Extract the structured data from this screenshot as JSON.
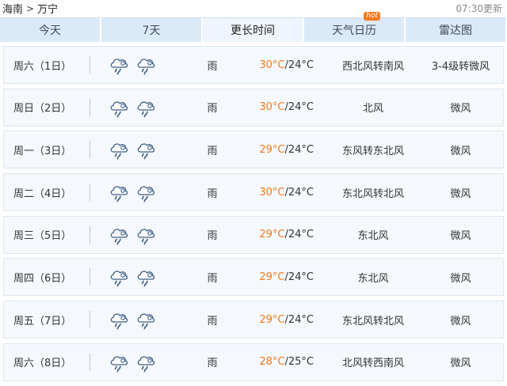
{
  "header": {
    "breadcrumb": {
      "province": "海南",
      "separator": ">",
      "city": "万宁"
    },
    "updated": "07:30更新"
  },
  "tabs": [
    {
      "label": "今天"
    },
    {
      "label": "7天"
    },
    {
      "label": "更长时间",
      "active": true
    },
    {
      "label": "天气日历",
      "badge": "hot"
    },
    {
      "label": "雷达图"
    }
  ],
  "forecast": [
    {
      "day": "周六（1日）",
      "icons": [
        "rain-cloud-icon",
        "rain-cloud-icon"
      ],
      "condition": "雨",
      "high": "30°C",
      "low": "/24°C",
      "wind": "西北风转南风",
      "level": "3-4级转微风"
    },
    {
      "day": "周日（2日）",
      "icons": [
        "rain-cloud-icon",
        "rain-cloud-icon"
      ],
      "condition": "雨",
      "high": "30°C",
      "low": "/24°C",
      "wind": "北风",
      "level": "微风"
    },
    {
      "day": "周一（3日）",
      "icons": [
        "rain-cloud-icon",
        "rain-cloud-icon"
      ],
      "condition": "雨",
      "high": "29°C",
      "low": "/24°C",
      "wind": "东风转东北风",
      "level": "微风"
    },
    {
      "day": "周二（4日）",
      "icons": [
        "rain-cloud-icon",
        "rain-cloud-icon"
      ],
      "condition": "雨",
      "high": "30°C",
      "low": "/24°C",
      "wind": "东北风转北风",
      "level": "微风"
    },
    {
      "day": "周三（5日）",
      "icons": [
        "rain-cloud-icon",
        "rain-cloud-icon"
      ],
      "condition": "雨",
      "high": "29°C",
      "low": "/24°C",
      "wind": "东北风",
      "level": "微风"
    },
    {
      "day": "周四（6日）",
      "icons": [
        "rain-cloud-icon",
        "rain-cloud-icon"
      ],
      "condition": "雨",
      "high": "29°C",
      "low": "/24°C",
      "wind": "东北风",
      "level": "微风"
    },
    {
      "day": "周五（7日）",
      "icons": [
        "rain-cloud-icon",
        "rain-cloud-icon"
      ],
      "condition": "雨",
      "high": "29°C",
      "low": "/24°C",
      "wind": "东北风转北风",
      "level": "微风"
    },
    {
      "day": "周六（8日）",
      "icons": [
        "rain-cloud-icon",
        "rain-cloud-icon"
      ],
      "condition": "雨",
      "high": "28°C",
      "low": "/25°C",
      "wind": "北风转西南风",
      "level": "微风"
    }
  ],
  "colors": {
    "tab_bg": "#dbeaf8",
    "row_bg": "#f5f8fc",
    "high_temp": "#f07a1b",
    "hot_badge": "#f57c1f"
  }
}
